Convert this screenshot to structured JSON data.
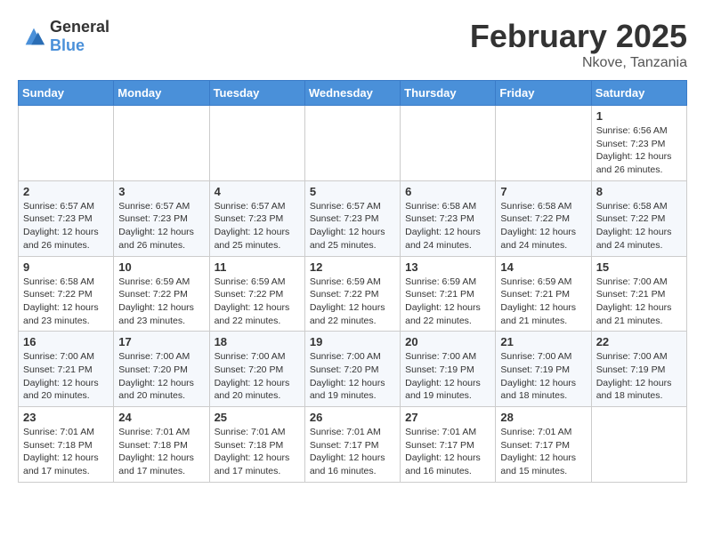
{
  "header": {
    "logo_general": "General",
    "logo_blue": "Blue",
    "month": "February 2025",
    "location": "Nkove, Tanzania"
  },
  "days_of_week": [
    "Sunday",
    "Monday",
    "Tuesday",
    "Wednesday",
    "Thursday",
    "Friday",
    "Saturday"
  ],
  "weeks": [
    [
      {
        "day": "",
        "info": ""
      },
      {
        "day": "",
        "info": ""
      },
      {
        "day": "",
        "info": ""
      },
      {
        "day": "",
        "info": ""
      },
      {
        "day": "",
        "info": ""
      },
      {
        "day": "",
        "info": ""
      },
      {
        "day": "1",
        "info": "Sunrise: 6:56 AM\nSunset: 7:23 PM\nDaylight: 12 hours and 26 minutes."
      }
    ],
    [
      {
        "day": "2",
        "info": "Sunrise: 6:57 AM\nSunset: 7:23 PM\nDaylight: 12 hours and 26 minutes."
      },
      {
        "day": "3",
        "info": "Sunrise: 6:57 AM\nSunset: 7:23 PM\nDaylight: 12 hours and 26 minutes."
      },
      {
        "day": "4",
        "info": "Sunrise: 6:57 AM\nSunset: 7:23 PM\nDaylight: 12 hours and 25 minutes."
      },
      {
        "day": "5",
        "info": "Sunrise: 6:57 AM\nSunset: 7:23 PM\nDaylight: 12 hours and 25 minutes."
      },
      {
        "day": "6",
        "info": "Sunrise: 6:58 AM\nSunset: 7:23 PM\nDaylight: 12 hours and 24 minutes."
      },
      {
        "day": "7",
        "info": "Sunrise: 6:58 AM\nSunset: 7:22 PM\nDaylight: 12 hours and 24 minutes."
      },
      {
        "day": "8",
        "info": "Sunrise: 6:58 AM\nSunset: 7:22 PM\nDaylight: 12 hours and 24 minutes."
      }
    ],
    [
      {
        "day": "9",
        "info": "Sunrise: 6:58 AM\nSunset: 7:22 PM\nDaylight: 12 hours and 23 minutes."
      },
      {
        "day": "10",
        "info": "Sunrise: 6:59 AM\nSunset: 7:22 PM\nDaylight: 12 hours and 23 minutes."
      },
      {
        "day": "11",
        "info": "Sunrise: 6:59 AM\nSunset: 7:22 PM\nDaylight: 12 hours and 22 minutes."
      },
      {
        "day": "12",
        "info": "Sunrise: 6:59 AM\nSunset: 7:22 PM\nDaylight: 12 hours and 22 minutes."
      },
      {
        "day": "13",
        "info": "Sunrise: 6:59 AM\nSunset: 7:21 PM\nDaylight: 12 hours and 22 minutes."
      },
      {
        "day": "14",
        "info": "Sunrise: 6:59 AM\nSunset: 7:21 PM\nDaylight: 12 hours and 21 minutes."
      },
      {
        "day": "15",
        "info": "Sunrise: 7:00 AM\nSunset: 7:21 PM\nDaylight: 12 hours and 21 minutes."
      }
    ],
    [
      {
        "day": "16",
        "info": "Sunrise: 7:00 AM\nSunset: 7:21 PM\nDaylight: 12 hours and 20 minutes."
      },
      {
        "day": "17",
        "info": "Sunrise: 7:00 AM\nSunset: 7:20 PM\nDaylight: 12 hours and 20 minutes."
      },
      {
        "day": "18",
        "info": "Sunrise: 7:00 AM\nSunset: 7:20 PM\nDaylight: 12 hours and 20 minutes."
      },
      {
        "day": "19",
        "info": "Sunrise: 7:00 AM\nSunset: 7:20 PM\nDaylight: 12 hours and 19 minutes."
      },
      {
        "day": "20",
        "info": "Sunrise: 7:00 AM\nSunset: 7:19 PM\nDaylight: 12 hours and 19 minutes."
      },
      {
        "day": "21",
        "info": "Sunrise: 7:00 AM\nSunset: 7:19 PM\nDaylight: 12 hours and 18 minutes."
      },
      {
        "day": "22",
        "info": "Sunrise: 7:00 AM\nSunset: 7:19 PM\nDaylight: 12 hours and 18 minutes."
      }
    ],
    [
      {
        "day": "23",
        "info": "Sunrise: 7:01 AM\nSunset: 7:18 PM\nDaylight: 12 hours and 17 minutes."
      },
      {
        "day": "24",
        "info": "Sunrise: 7:01 AM\nSunset: 7:18 PM\nDaylight: 12 hours and 17 minutes."
      },
      {
        "day": "25",
        "info": "Sunrise: 7:01 AM\nSunset: 7:18 PM\nDaylight: 12 hours and 17 minutes."
      },
      {
        "day": "26",
        "info": "Sunrise: 7:01 AM\nSunset: 7:17 PM\nDaylight: 12 hours and 16 minutes."
      },
      {
        "day": "27",
        "info": "Sunrise: 7:01 AM\nSunset: 7:17 PM\nDaylight: 12 hours and 16 minutes."
      },
      {
        "day": "28",
        "info": "Sunrise: 7:01 AM\nSunset: 7:17 PM\nDaylight: 12 hours and 15 minutes."
      },
      {
        "day": "",
        "info": ""
      }
    ]
  ]
}
